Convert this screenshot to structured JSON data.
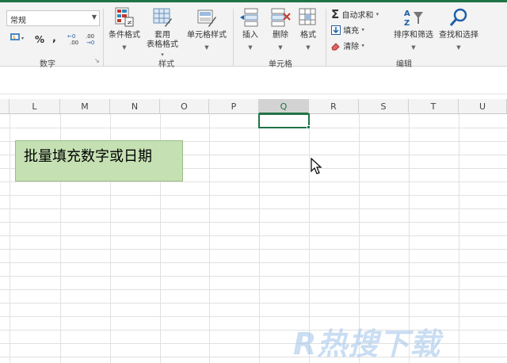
{
  "ribbon": {
    "number_group": {
      "format_value": "常规",
      "percent_label": "%",
      "comma_label": ",",
      "increase_decimal_label": "←0 .00",
      "decrease_decimal_label": ".00 →0",
      "group_label": "数字"
    },
    "styles_group": {
      "conditional_format_label": "条件格式",
      "table_format_label_line1": "套用",
      "table_format_label_line2": "表格格式",
      "cell_styles_label": "单元格样式",
      "group_label": "样式"
    },
    "cells_group": {
      "insert_label": "插入",
      "delete_label": "删除",
      "format_label": "格式",
      "group_label": "单元格"
    },
    "editing_group": {
      "autosum_label": "自动求和",
      "fill_label": "填充",
      "clear_label": "清除",
      "sort_filter_label": "排序和筛选",
      "find_select_label": "查找和选择",
      "group_label": "编辑"
    }
  },
  "grid": {
    "columns": [
      "L",
      "M",
      "N",
      "O",
      "P",
      "Q",
      "R",
      "S",
      "T",
      "U"
    ],
    "selected_column": "Q"
  },
  "textbox": {
    "text": "批量填充数字或日期",
    "fill_color": "#c5e0b3"
  },
  "watermark": {
    "text": "R热搜下载"
  },
  "colors": {
    "accent": "#217346"
  }
}
